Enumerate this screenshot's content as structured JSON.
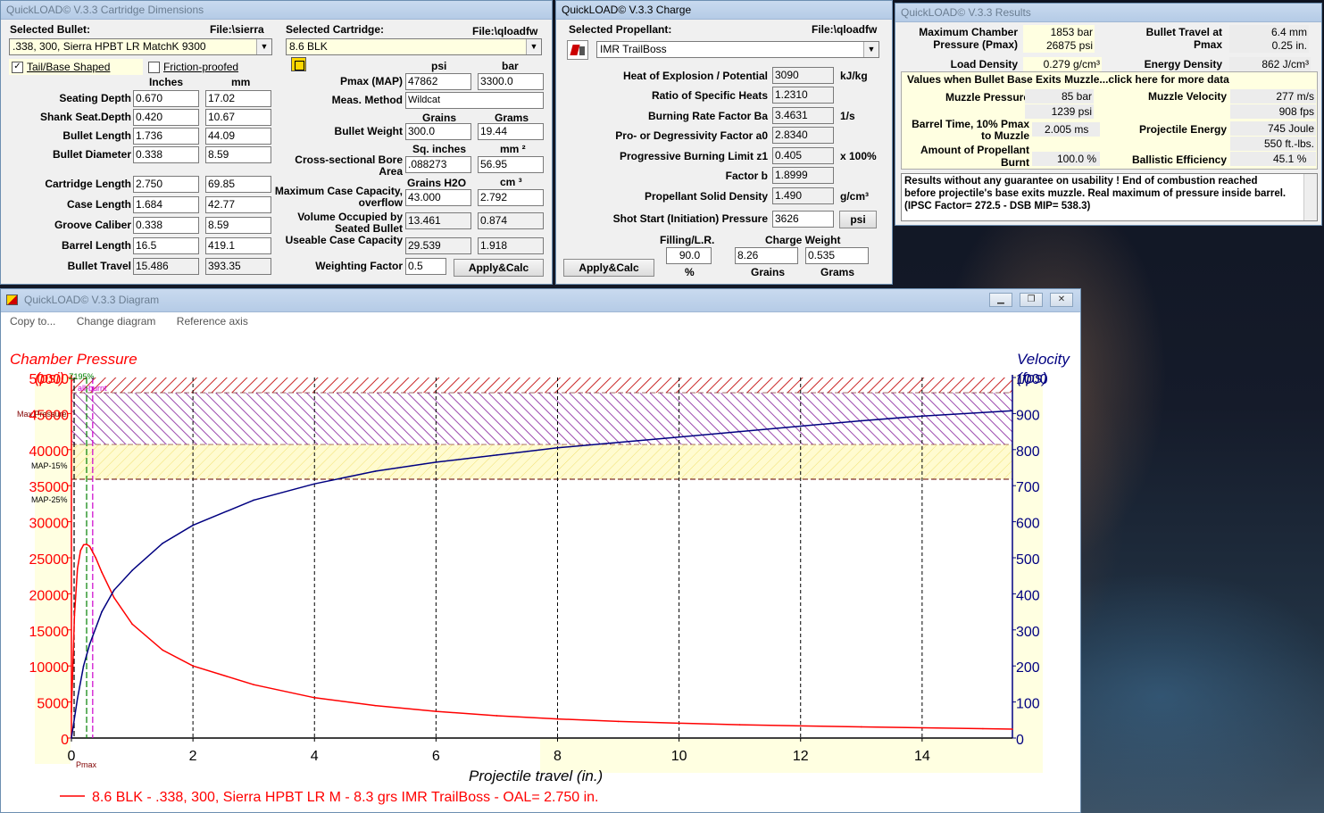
{
  "cartridge_win": {
    "title": "QuickLOAD© V.3.3 Cartridge Dimensions",
    "selected_bullet_label": "Selected Bullet:",
    "bullet_file": "File:\\sierra",
    "bullet_value": ".338, 300, Sierra HPBT LR MatchK 9300",
    "selected_cartridge_label": "Selected Cartridge:",
    "cartridge_file": "File:\\qloadfw",
    "cartridge_value": "8.6 BLK",
    "tail_label": "Tail/Base Shaped",
    "tail_check": "✓",
    "friction_label": "Friction-proofed",
    "inches": "Inches",
    "mm": "mm",
    "rows": [
      {
        "label": "Seating Depth",
        "in": "0.670",
        "mm": "17.02"
      },
      {
        "label": "Shank Seat.Depth",
        "in": "0.420",
        "mm": "10.67"
      },
      {
        "label": "Bullet Length",
        "in": "1.736",
        "mm": "44.09"
      },
      {
        "label": "Bullet Diameter",
        "in": "0.338",
        "mm": "8.59"
      },
      {
        "label": "Cartridge Length",
        "in": "2.750",
        "mm": "69.85"
      },
      {
        "label": "Case Length",
        "in": "1.684",
        "mm": "42.77"
      },
      {
        "label": "Groove Caliber",
        "in": "0.338",
        "mm": "8.59"
      },
      {
        "label": "Barrel Length",
        "in": "16.5",
        "mm": "419.1"
      },
      {
        "label": "Bullet Travel",
        "in": "15.486",
        "mm": "393.35"
      }
    ],
    "psi_hdr": "psi",
    "bar_hdr": "bar",
    "pmax_label": "Pmax (MAP)",
    "pmax_psi": "47862",
    "pmax_bar": "3300.0",
    "meas_label": "Meas. Method",
    "meas_value": "Wildcat",
    "grains_hdr": "Grains",
    "grams_hdr": "Grams",
    "bw_label": "Bullet Weight",
    "bw_gr": "300.0",
    "bw_g": "19.44",
    "sq_hdr": "Sq. inches",
    "mm2_hdr": "mm ²",
    "bore_label1": "Cross-sectional Bore",
    "bore_label2": "Area",
    "bore_sq": ".088273",
    "bore_mm2": "56.95",
    "h2o_hdr": "Grains H2O",
    "cm3_hdr": "cm ³",
    "cap_label1": "Maximum Case Capacity,",
    "cap_label2": "overflow",
    "cap_gr": "43.000",
    "cap_cm": "2.792",
    "vol_label1": "Volume Occupied by",
    "vol_label2": "Seated Bullet",
    "vol_gr": "13.461",
    "vol_cm": "0.874",
    "use_label": "Useable Case Capacity",
    "use_gr": "29.539",
    "use_cm": "1.918",
    "wf_label": "Weighting Factor",
    "wf_value": "0.5",
    "apply": "Apply&Calc"
  },
  "charge_win": {
    "title": "QuickLOAD© V.3.3 Charge",
    "selected_label": "Selected Propellant:",
    "file": "File:\\qloadfw",
    "propellant": "IMR TrailBoss",
    "rows": [
      {
        "label": "Heat of Explosion / Potential",
        "value": "3090",
        "unit": "kJ/kg"
      },
      {
        "label": "Ratio of Specific Heats",
        "value": "1.2310",
        "unit": ""
      },
      {
        "label": "Burning Rate Factor  Ba",
        "value": "3.4631",
        "unit": "1/s"
      },
      {
        "label": "Pro- or Degressivity Factor  a0",
        "value": "2.8340",
        "unit": ""
      },
      {
        "label": "Progressive Burning Limit z1",
        "value": "0.405",
        "unit": "x 100%"
      },
      {
        "label": "Factor  b",
        "value": "1.8999",
        "unit": ""
      },
      {
        "label": "Propellant Solid Density",
        "value": "1.490",
        "unit": "g/cm³"
      }
    ],
    "shot_label": "Shot Start (Initiation) Pressure",
    "shot_value": "3626",
    "shot_unit": "psi",
    "fill_label": "Filling/L.R.",
    "fill_value": "90.0",
    "fill_unit": "%",
    "cw_label": "Charge Weight",
    "cw_gr": "8.26",
    "cw_g": "0.535",
    "grains": "Grains",
    "grams": "Grams",
    "apply": "Apply&Calc"
  },
  "results_win": {
    "title": "QuickLOAD© V.3.3 Results",
    "mcp_label1": "Maximum Chamber",
    "mcp_label2": "Pressure (Pmax)",
    "mcp_bar": "1853 bar",
    "mcp_psi": "26875 psi",
    "bt_label1": "Bullet Travel at",
    "bt_label2": "Pmax",
    "bt_mm": "6.4 mm",
    "bt_in": "0.25 in.",
    "ld_label": "Load Density",
    "ld_value": "0.279 g/cm³",
    "ed_label": "Energy Density",
    "ed_value": "862 J/cm³",
    "muzzle_hdr": "Values when Bullet Base Exits Muzzle...click here for more data",
    "mp_label": "Muzzle Pressure",
    "mp_bar": "85 bar",
    "mp_psi": "1239 psi",
    "mv_label": "Muzzle Velocity",
    "mv_ms": "277 m/s",
    "mv_fps": "908 fps",
    "bt10_label1": "Barrel Time, 10% Pmax",
    "bt10_label2": "to Muzzle",
    "bt10_value": "2.005 ms",
    "pe_label": "Projectile Energy",
    "pe_j": "745 Joule",
    "pe_ft": "550 ft.-lbs.",
    "ab_label1": "Amount of Propellant",
    "ab_label2": "Burnt",
    "ab_value": "100.0 %",
    "be_label": "Ballistic Efficiency",
    "be_value": "45.1 %",
    "note_line1": "Results without any guarantee on usability !  End of combustion reached",
    "note_line2": "before projectile's base exits muzzle.  Real maximum of pressure inside barrel.",
    "note_line3": "(IPSC Factor= 272.5 - DSB MIP= 538.3)"
  },
  "diagram_win": {
    "title": "QuickLOAD© V.3.3 Diagram",
    "menu": [
      "Copy to...",
      "Change diagram",
      "Reference axis"
    ],
    "left_title1": "Chamber Pressure",
    "left_title2": "(psi)",
    "right_title1": "Velocity",
    "right_title2": "(fps)",
    "xlabel": "Projectile travel (in.)",
    "z_label": "Z195%",
    "burnt_label": "all-burnt",
    "maxp_label": "Max.Pressure",
    "map1_label": "MAP-15%",
    "map2_label": "MAP-25%",
    "pmax_marker": "Pmax",
    "legend": "8.6 BLK - .338, 300, Sierra HPBT LR M - 8.3 grs IMR TrailBoss - OAL= 2.750 in."
  },
  "chart_data": {
    "type": "line",
    "xlabel": "Projectile travel (in.)",
    "ylabel": "Chamber Pressure (psi)",
    "y2label": "Velocity (fps)",
    "xlim": [
      0,
      15.486
    ],
    "ylim": [
      0,
      50000
    ],
    "y2lim": [
      0,
      1000
    ],
    "xticks": [
      0,
      2,
      4,
      6,
      8,
      10,
      12,
      14
    ],
    "yticks": [
      0,
      5000,
      10000,
      15000,
      20000,
      25000,
      30000,
      35000,
      40000,
      45000,
      50000
    ],
    "y2ticks": [
      0,
      100,
      200,
      300,
      400,
      500,
      600,
      700,
      800,
      900,
      1000
    ],
    "grid": true,
    "series": [
      {
        "name": "8.6 BLK - .338, 300, Sierra HPBT LR M - 8.3 grs IMR TrailBoss - OAL= 2.750 in.",
        "axis": "left",
        "color": "#ff0000",
        "x": [
          0,
          0.02,
          0.05,
          0.1,
          0.15,
          0.2,
          0.25,
          0.3,
          0.4,
          0.5,
          0.7,
          1.0,
          1.5,
          2.0,
          3.0,
          4.0,
          5.0,
          6.0,
          7.0,
          8.0,
          9.0,
          10.0,
          11.0,
          12.0,
          13.0,
          14.0,
          15.0,
          15.486
        ],
        "y": [
          3626,
          9000,
          17000,
          23500,
          26000,
          26800,
          26875,
          26600,
          25000,
          23000,
          19500,
          15800,
          12200,
          10000,
          7400,
          5600,
          4500,
          3700,
          3100,
          2650,
          2300,
          2050,
          1850,
          1680,
          1550,
          1420,
          1300,
          1239
        ]
      },
      {
        "name": "Velocity",
        "axis": "right",
        "color": "#000080",
        "x": [
          0,
          0.1,
          0.2,
          0.3,
          0.5,
          0.7,
          1.0,
          1.5,
          2.0,
          3.0,
          4.0,
          5.0,
          6.0,
          7.0,
          8.0,
          9.0,
          10.0,
          11.0,
          12.0,
          13.0,
          14.0,
          15.0,
          15.486
        ],
        "y": [
          0,
          110,
          200,
          260,
          350,
          410,
          465,
          540,
          590,
          660,
          705,
          740,
          765,
          785,
          805,
          820,
          835,
          850,
          865,
          880,
          893,
          903,
          908
        ]
      }
    ],
    "bands": [
      {
        "name": "Max.Pressure",
        "y": [
          47862,
          50000
        ],
        "color": "#c00000"
      },
      {
        "name": "MAP-15%",
        "y": [
          40683,
          47862
        ],
        "color": "#800080"
      },
      {
        "name": "MAP-25%",
        "y": [
          35897,
          40683
        ],
        "color": "#ffffe1"
      }
    ],
    "markers": [
      {
        "name": "Z195%",
        "x": 0.25,
        "color": "#008000"
      },
      {
        "name": "all-burnt",
        "x": 0.35,
        "color": "#cc00cc"
      },
      {
        "name": "Pmax",
        "x": 0.25,
        "color": "#000000"
      }
    ]
  }
}
